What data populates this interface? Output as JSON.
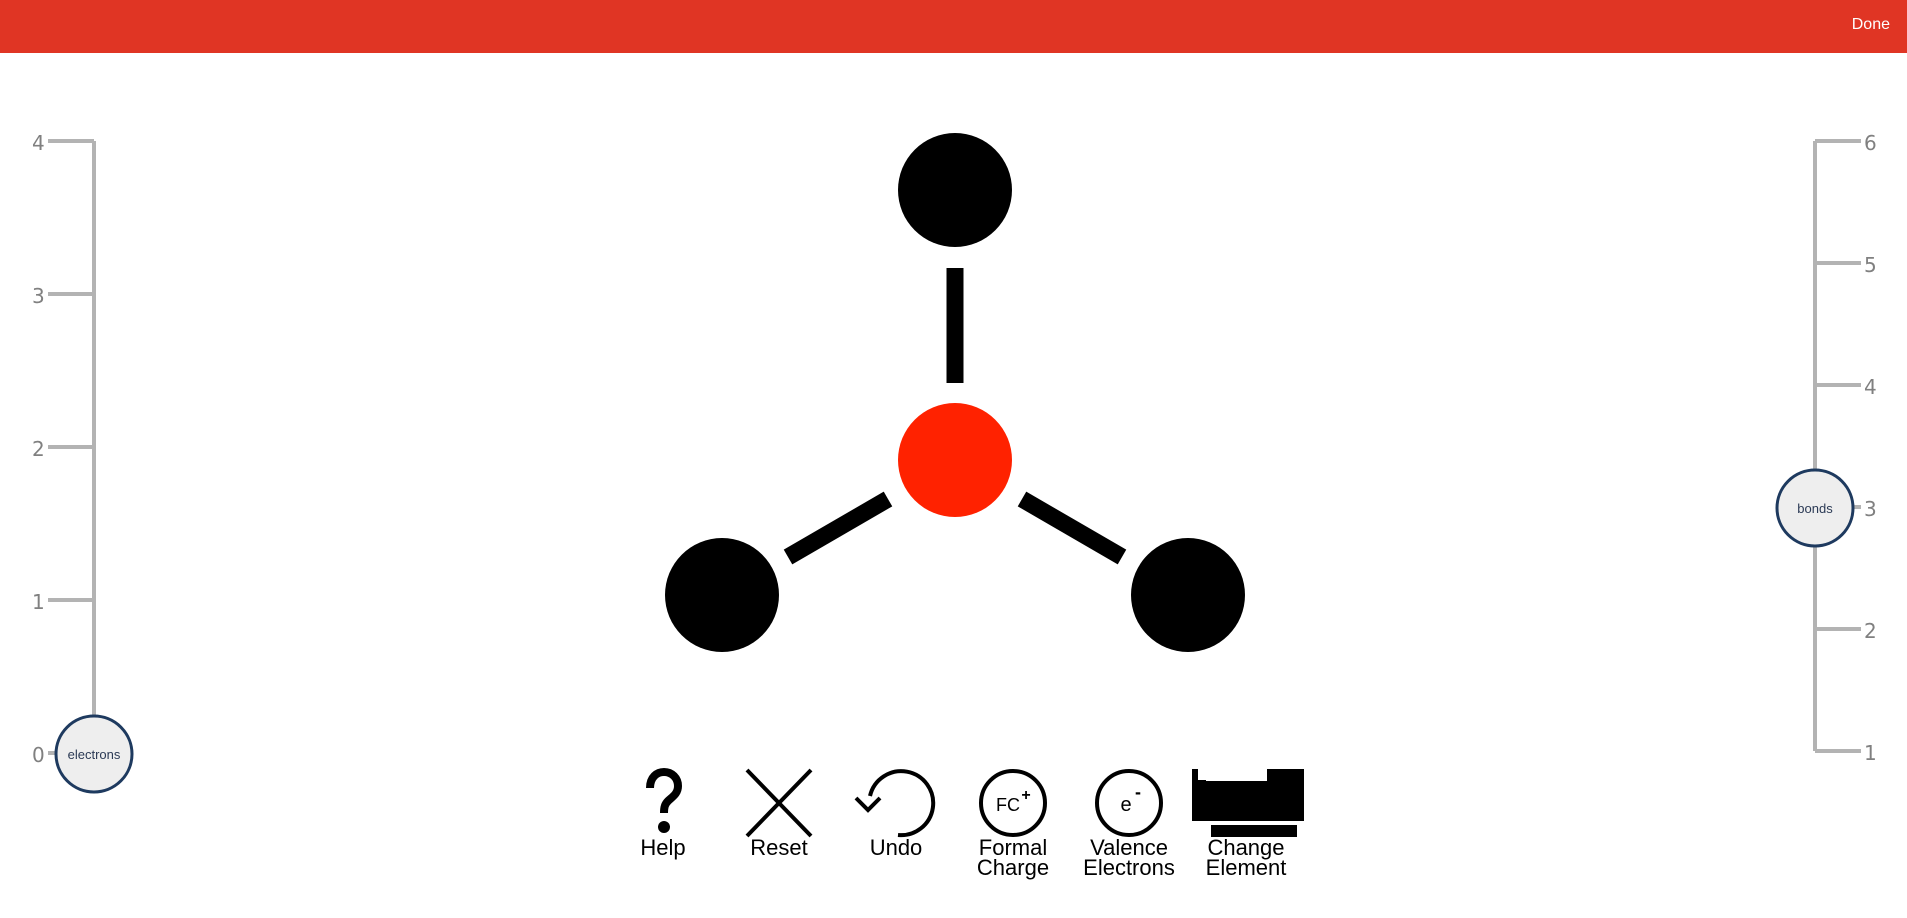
{
  "header": {
    "done_label": "Done",
    "bar_color": "#e03524"
  },
  "electrons_slider": {
    "ticks": [
      "0",
      "1",
      "2",
      "3",
      "4"
    ],
    "value": 0,
    "knob_label": "electrons"
  },
  "bonds_slider": {
    "ticks": [
      "1",
      "2",
      "3",
      "4",
      "5",
      "6"
    ],
    "value": 3,
    "knob_label": "bonds"
  },
  "molecule": {
    "central_atom_color": "#ff2200",
    "outer_atom_color": "#000000",
    "bond_count": 3
  },
  "toolbar": {
    "help": {
      "label": "Help",
      "icon": "question-mark-icon"
    },
    "reset": {
      "label": "Reset",
      "icon": "x-icon"
    },
    "undo": {
      "label": "Undo",
      "icon": "undo-arrow-icon"
    },
    "formal_charge": {
      "label": "Formal\nCharge",
      "icon_text": "FC",
      "icon_sup": "+"
    },
    "valence_electrons": {
      "label": "Valence\nElectrons",
      "icon_text": "e",
      "icon_sup": "-"
    },
    "change_element": {
      "label": "Change\nElement",
      "icon": "periodic-table-icon"
    }
  }
}
